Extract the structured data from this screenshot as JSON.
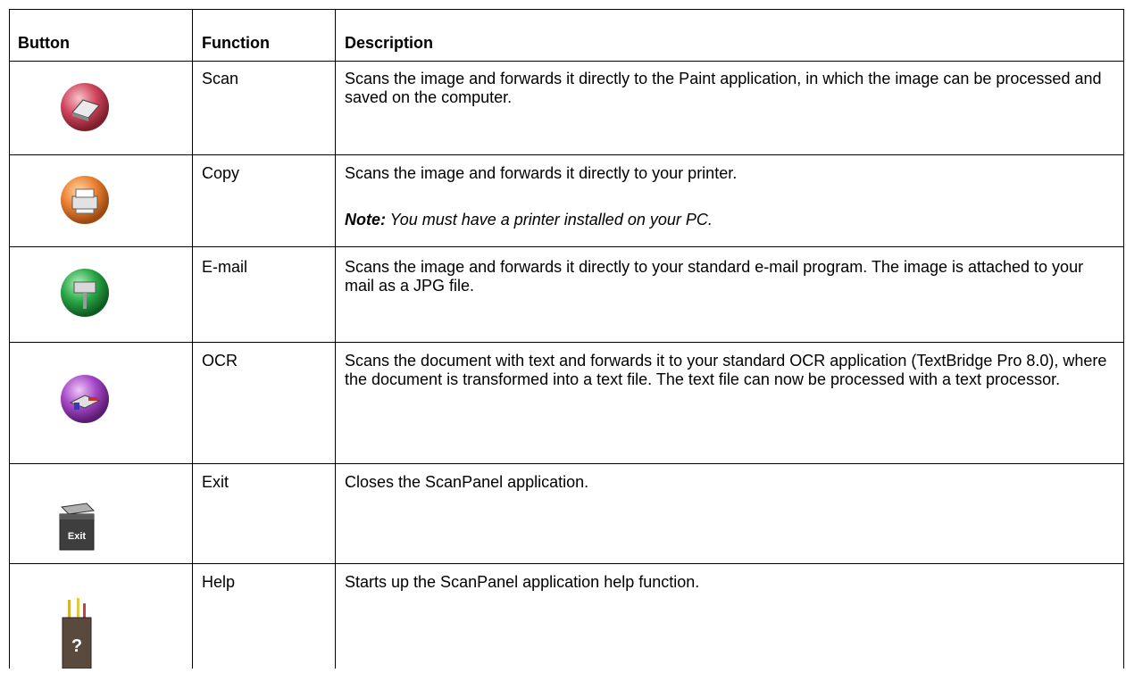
{
  "header": {
    "button": "Button",
    "function": "Function",
    "description": "Description"
  },
  "rows": [
    {
      "icon": "scan-icon",
      "function": "Scan",
      "description": "Scans the image and forwards it directly to the Paint application, in which the image can be processed and saved on the computer."
    },
    {
      "icon": "copy-icon",
      "function": "Copy",
      "description": "Scans the image and forwards it directly to your printer.",
      "note_label": "Note:",
      "note_text": " You must have a printer installed on your PC."
    },
    {
      "icon": "email-icon",
      "function": "E-mail",
      "description": "Scans the image and forwards it directly to your standard e-mail program. The image is attached to your mail as a JPG file."
    },
    {
      "icon": "ocr-icon",
      "function": "OCR",
      "description": "Scans the document with text and forwards it to your standard OCR application (TextBridge Pro 8.0), where the document is transformed into a text file. The text file can now be processed with a text processor."
    },
    {
      "icon": "exit-icon",
      "function": "Exit",
      "icon_label": "Exit",
      "description": "Closes the ScanPanel application."
    },
    {
      "icon": "help-icon",
      "function": "Help",
      "icon_label": "?",
      "description": "Starts up the ScanPanel application help function."
    }
  ]
}
